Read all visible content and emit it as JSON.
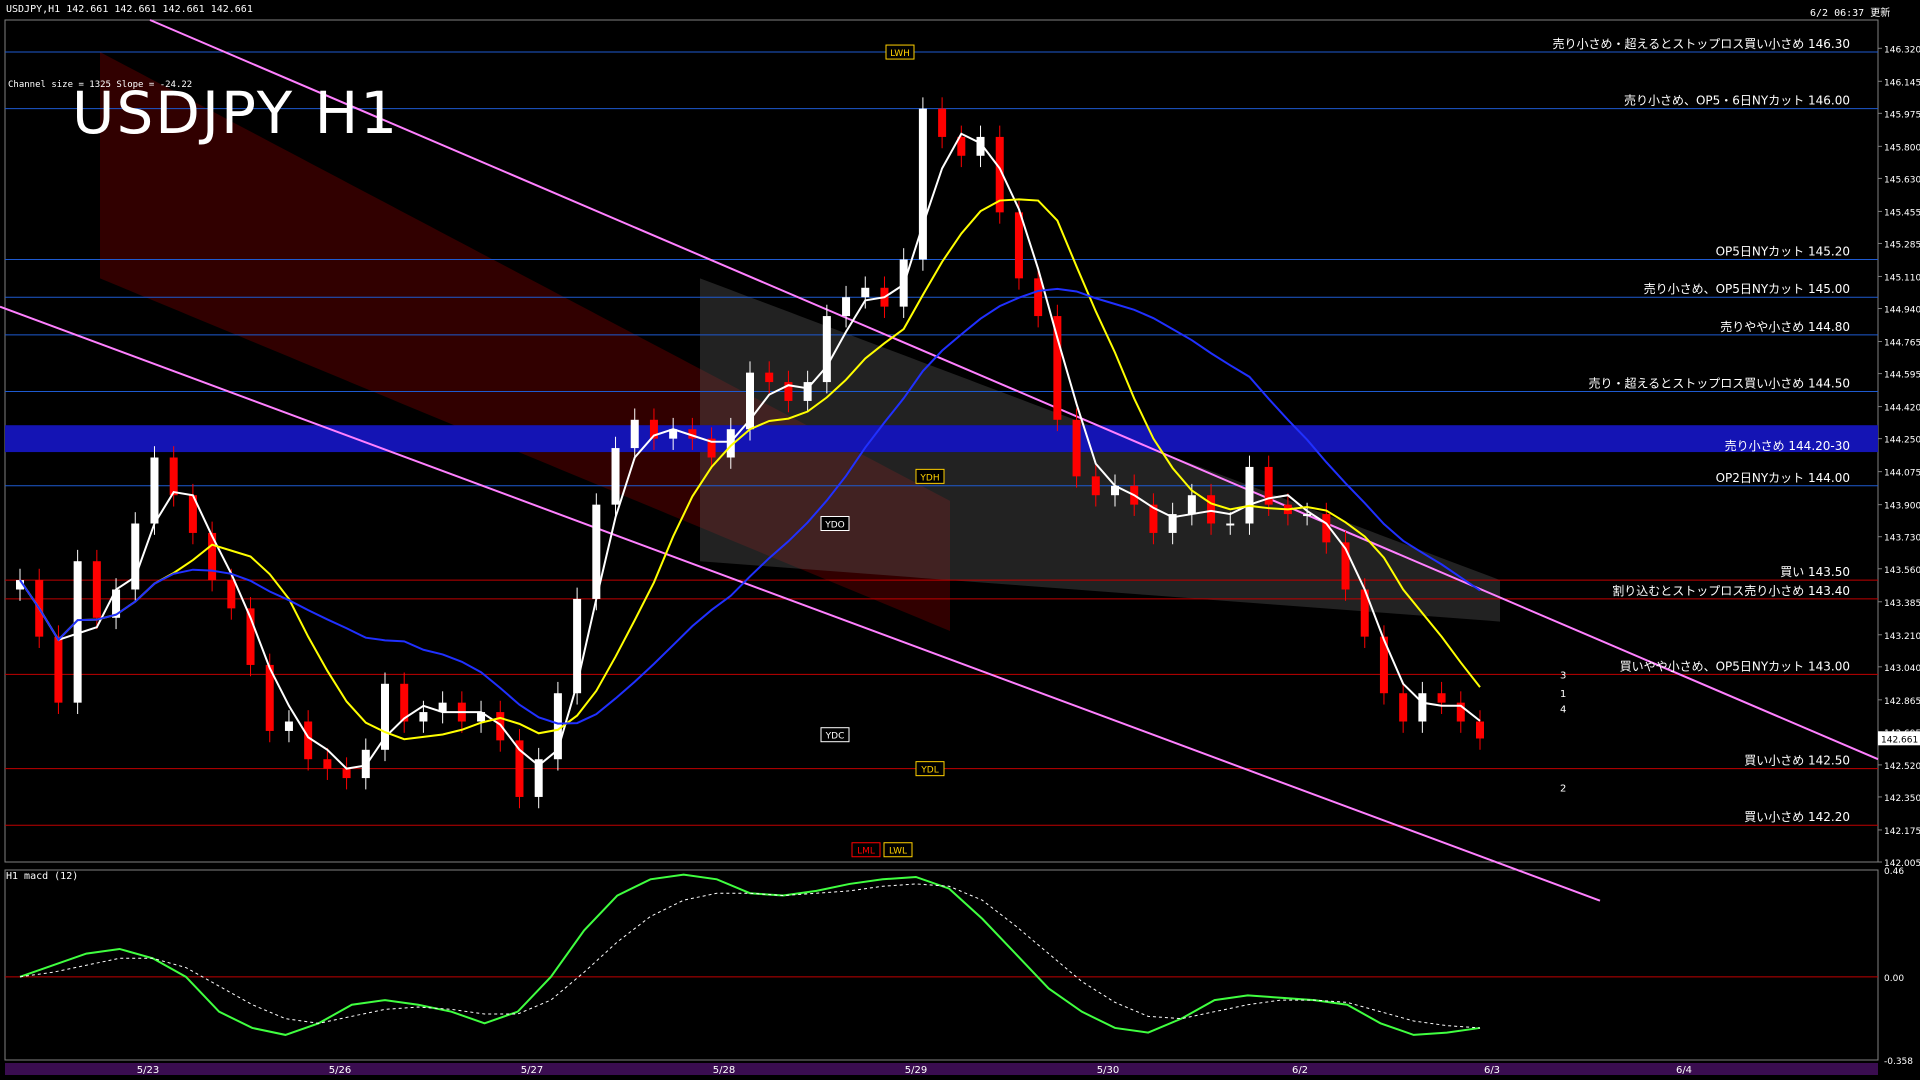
{
  "header": {
    "symbol_info": "USDJPY,H1  142.661 142.661 142.661 142.661",
    "updated": "6/2 06:37 更新",
    "channel_info": "Channel size = 1325 Slope = -24.22",
    "big_title": "USDJPY H1",
    "macd_title": "H1  macd (12)"
  },
  "colors": {
    "background": "#000000",
    "bull_candle": "#ffffff",
    "bear_candle": "#ff0000",
    "level_line_blue": "#1e5ad0",
    "level_line_red": "#c00000",
    "zone_band": "#1414b4",
    "ma_white": "#ffffff",
    "ma_yellow": "#ffff00",
    "ma_blue": "#2030ff",
    "chikou_green": "#00c000",
    "channel_line": "#ff80ff",
    "macd_green": "#40ff40",
    "macd_pink": "#ff8080"
  },
  "chart_data": {
    "type": "candlestick",
    "symbol": "USDJPY",
    "timeframe": "H1",
    "ylim": [
      142.005,
      146.47
    ],
    "y_ticks": [
      146.32,
      146.145,
      145.975,
      145.8,
      145.63,
      145.455,
      145.285,
      145.11,
      144.94,
      144.765,
      144.595,
      144.42,
      144.25,
      144.075,
      143.9,
      143.73,
      143.56,
      143.385,
      143.21,
      143.04,
      142.865,
      142.695,
      142.52,
      142.35,
      142.175,
      142.005
    ],
    "last_price": "142.661",
    "x_labels": [
      "5/23",
      "5/26",
      "5/27",
      "5/28",
      "5/29",
      "5/30",
      "6/2",
      "6/3",
      "6/4"
    ],
    "close_path": [
      143.5,
      143.2,
      142.85,
      143.6,
      143.3,
      143.45,
      143.8,
      144.15,
      143.95,
      143.75,
      143.5,
      143.35,
      143.05,
      142.7,
      142.75,
      142.55,
      142.5,
      142.45,
      142.6,
      142.95,
      142.75,
      142.8,
      142.85,
      142.75,
      142.8,
      142.65,
      142.35,
      142.55,
      142.9,
      143.4,
      143.9,
      144.2,
      144.35,
      144.25,
      144.3,
      144.25,
      144.15,
      144.3,
      144.6,
      144.55,
      144.45,
      144.55,
      144.9,
      145.0,
      145.05,
      144.95,
      145.2,
      146.0,
      145.85,
      145.75,
      145.85,
      145.45,
      145.1,
      144.9,
      144.35,
      144.05,
      143.95,
      144.0,
      143.9,
      143.75,
      143.85,
      143.95,
      143.8,
      143.8,
      144.1,
      143.9,
      143.85,
      143.85,
      143.7,
      143.45,
      143.2,
      142.9,
      142.75,
      142.9,
      142.85,
      142.75,
      142.66
    ],
    "levels": [
      {
        "price": 146.3,
        "label": "売り小さめ・超えるとストップロス買い小さめ 146.30",
        "color": "#1e5ad0"
      },
      {
        "price": 146.0,
        "label": "売り小さめ、OP5・6日NYカット 146.00",
        "color": "#1e5ad0"
      },
      {
        "price": 145.2,
        "label": "OP5日NYカット 145.20",
        "color": "#1e5ad0"
      },
      {
        "price": 145.0,
        "label": "売り小さめ、OP5日NYカット 145.00",
        "color": "#1e5ad0"
      },
      {
        "price": 144.8,
        "label": "売りやや小さめ 144.80",
        "color": "#1e5ad0"
      },
      {
        "price": 144.5,
        "label": "売り・超えるとストップロス買い小さめ 144.50",
        "color": "#1e5ad0"
      },
      {
        "price": 144.0,
        "label": "OP2日NYカット 144.00",
        "color": "#1e5ad0"
      },
      {
        "price": 143.5,
        "label": "買い 143.50",
        "color": "#c00000"
      },
      {
        "price": 143.4,
        "label": "割り込むとストップロス売り小さめ 143.40",
        "color": "#c00000"
      },
      {
        "price": 143.0,
        "label": "買いやや小さめ、OP5日NYカット 143.00",
        "color": "#c00000"
      },
      {
        "price": 142.5,
        "label": "買い小さめ 142.50",
        "color": "#c00000"
      },
      {
        "price": 142.2,
        "label": "買い小さめ 142.20",
        "color": "#c00000"
      }
    ],
    "zone": {
      "low": 144.2,
      "high": 144.3,
      "label": "売り小さめ 144.20-30"
    },
    "markers": [
      {
        "label": "LWH",
        "price": 146.3
      },
      {
        "label": "YDH",
        "price": 144.05
      },
      {
        "label": "YDO",
        "price": 143.8
      },
      {
        "label": "YDC",
        "price": 142.68
      },
      {
        "label": "YDL",
        "price": 142.5
      },
      {
        "label": "LWL",
        "price": 142.07
      },
      {
        "label": "LML",
        "price": 142.07
      }
    ],
    "projection_labels": [
      "3",
      "1",
      "4",
      "2"
    ],
    "macd": {
      "ylim": [
        -0.358,
        0.46
      ],
      "y_ticks": [
        "0.46",
        "0.00",
        "-0.358"
      ],
      "main": [
        0.0,
        0.05,
        0.1,
        0.12,
        0.08,
        0.0,
        -0.15,
        -0.22,
        -0.25,
        -0.2,
        -0.12,
        -0.1,
        -0.12,
        -0.15,
        -0.2,
        -0.15,
        0.0,
        0.2,
        0.35,
        0.42,
        0.44,
        0.42,
        0.36,
        0.35,
        0.37,
        0.4,
        0.42,
        0.43,
        0.38,
        0.25,
        0.1,
        -0.05,
        -0.15,
        -0.22,
        -0.24,
        -0.18,
        -0.1,
        -0.08,
        -0.09,
        -0.1,
        -0.12,
        -0.2,
        -0.25,
        -0.24,
        -0.22
      ],
      "signal": [
        0.0,
        0.02,
        0.05,
        0.08,
        0.08,
        0.04,
        -0.04,
        -0.12,
        -0.18,
        -0.2,
        -0.17,
        -0.14,
        -0.13,
        -0.14,
        -0.16,
        -0.16,
        -0.1,
        0.02,
        0.15,
        0.26,
        0.33,
        0.36,
        0.36,
        0.35,
        0.36,
        0.37,
        0.39,
        0.4,
        0.39,
        0.33,
        0.22,
        0.1,
        -0.02,
        -0.11,
        -0.17,
        -0.18,
        -0.15,
        -0.12,
        -0.1,
        -0.1,
        -0.11,
        -0.15,
        -0.19,
        -0.21,
        -0.22
      ]
    }
  }
}
